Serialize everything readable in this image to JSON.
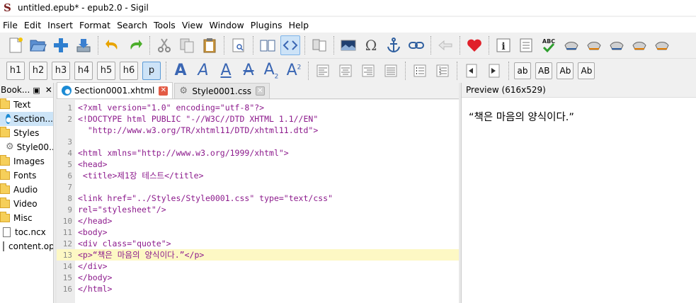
{
  "window": {
    "title": "untitled.epub* - epub2.0 - Sigil",
    "app_icon": "S"
  },
  "menubar": [
    "File",
    "Edit",
    "Insert",
    "Format",
    "Search",
    "Tools",
    "View",
    "Window",
    "Plugins",
    "Help"
  ],
  "headings": [
    "h1",
    "h2",
    "h3",
    "h4",
    "h5",
    "h6",
    "p"
  ],
  "case_buttons": [
    "ab",
    "AB",
    "Ab",
    "Ab"
  ],
  "book_browser": {
    "title": "Book...",
    "items": [
      {
        "label": "Text",
        "type": "folder"
      },
      {
        "label": "Section...",
        "type": "html"
      },
      {
        "label": "Styles",
        "type": "folder"
      },
      {
        "label": "Style00...",
        "type": "css"
      },
      {
        "label": "Images",
        "type": "folder"
      },
      {
        "label": "Fonts",
        "type": "folder"
      },
      {
        "label": "Audio",
        "type": "folder"
      },
      {
        "label": "Video",
        "type": "folder"
      },
      {
        "label": "Misc",
        "type": "folder"
      },
      {
        "label": "toc.ncx",
        "type": "file"
      },
      {
        "label": "content.opf",
        "type": "file"
      }
    ]
  },
  "tabs": [
    {
      "label": "Section0001.xhtml",
      "active": true
    },
    {
      "label": "Style0001.css",
      "active": false
    }
  ],
  "editor": {
    "line_numbers": [
      "1",
      "2",
      "3",
      "4",
      "5",
      "6",
      "7",
      "8",
      "9",
      "10",
      "11",
      "12",
      "13",
      "14",
      "15",
      "16"
    ],
    "lines": [
      "<?xml version=\"1.0\" encoding=\"utf-8\"?>",
      "<!DOCTYPE html PUBLIC \"-//W3C//DTD XHTML 1.1//EN\"",
      "  \"http://www.w3.org/TR/xhtml11/DTD/xhtml11.dtd\">",
      "",
      "<html xmlns=\"http://www.w3.org/1999/xhtml\">",
      "<head>",
      " <title>제1장 테스트</title>",
      "",
      "<link href=\"../Styles/Style0001.css\" type=\"text/css\"",
      "rel=\"stylesheet\"/>",
      "</head>",
      "<body>",
      "<div class=\"quote\">",
      "<p>“책은 마음의 양식이다.”</p>",
      "</div>",
      "</body>",
      "</html>"
    ]
  },
  "preview": {
    "title": "Preview (616x529)",
    "text": "“책은 마음의 양식이다.”"
  },
  "colors": {
    "tag": "#8c1a8c",
    "string": "#1a1a8c",
    "highlight": "#fdf8c4",
    "accent": "#3a66b3"
  }
}
